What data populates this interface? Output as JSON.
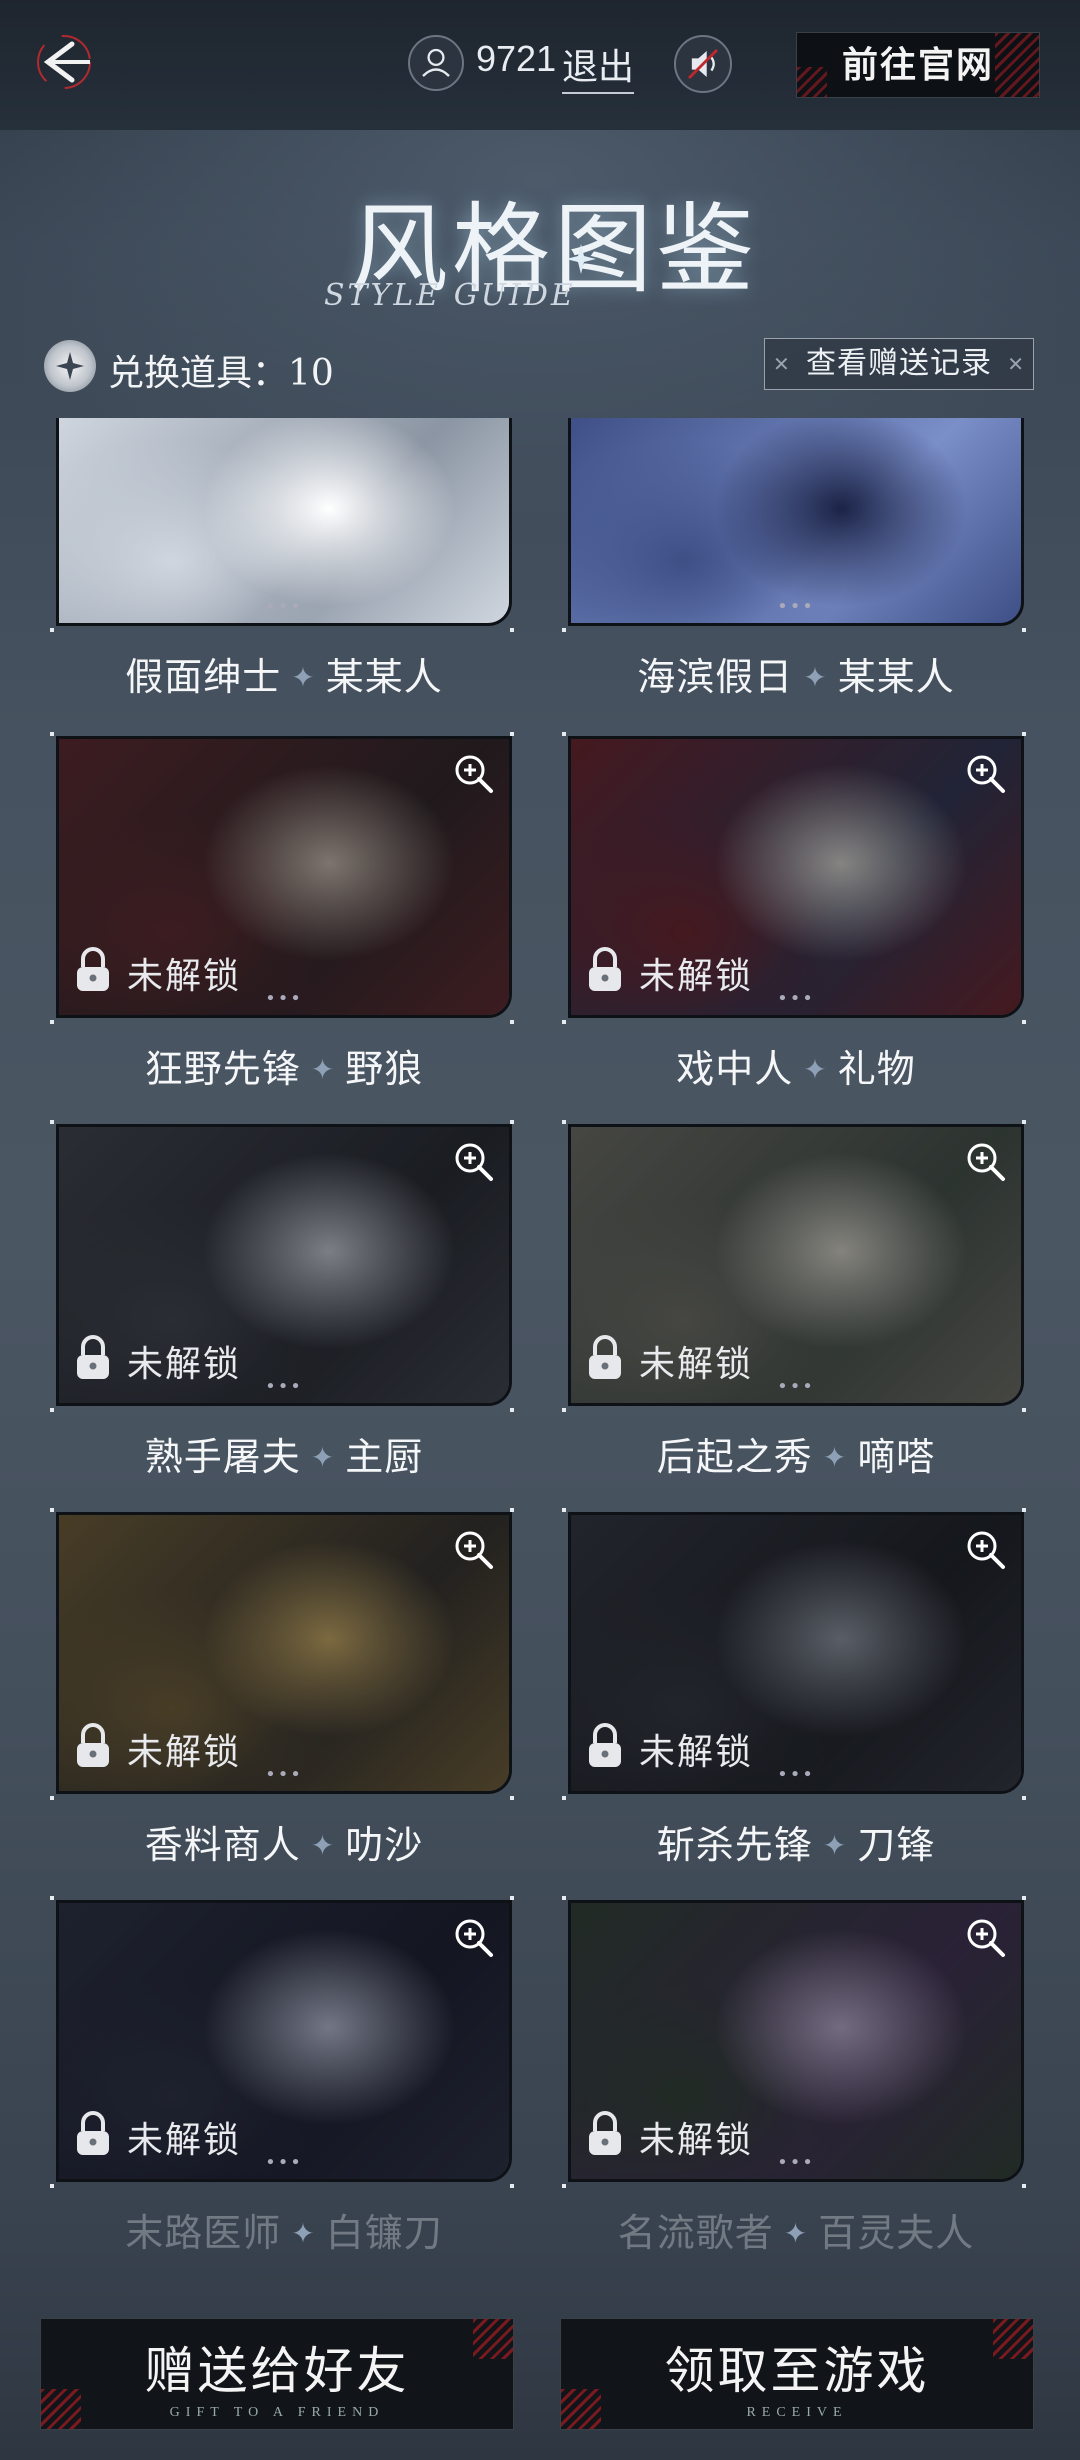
{
  "header": {
    "user_id": "9721",
    "logout_label": "退出",
    "website_button": "前往官网"
  },
  "title": {
    "main": "风格图鉴",
    "sub": "STYLE GUIDE"
  },
  "exchange": {
    "label": "兑换道具：",
    "count": "10",
    "records_button": "查看赠送记录"
  },
  "locked_text": "未解锁",
  "cards": [
    {
      "style": "假面绅士",
      "character": "某某人",
      "locked": false,
      "palette": [
        "#cfd6df",
        "#8b95a3",
        "#ffffff"
      ]
    },
    {
      "style": "海滨假日",
      "character": "某某人",
      "locked": false,
      "palette": [
        "#3e4f86",
        "#7a8ec8",
        "#1b2346"
      ]
    },
    {
      "style": "狂野先锋",
      "character": "野狼",
      "locked": true,
      "palette": [
        "#5b2224",
        "#2a1d1d",
        "#c9b9a8"
      ]
    },
    {
      "style": "戏中人",
      "character": "礼物",
      "locked": true,
      "palette": [
        "#6a1c22",
        "#2b2f4a",
        "#d8d4cc"
      ]
    },
    {
      "style": "熟手屠夫",
      "character": "主厨",
      "locked": true,
      "palette": [
        "#3b3f45",
        "#1f2226",
        "#c6cbd1"
      ]
    },
    {
      "style": "后起之秀",
      "character": "嘀嗒",
      "locked": true,
      "palette": [
        "#6b6a5e",
        "#3f4a3f",
        "#d6d2c4"
      ]
    },
    {
      "style": "香料商人",
      "character": "叻沙",
      "locked": true,
      "palette": [
        "#6e5a2e",
        "#2e2a22",
        "#c7a65a"
      ]
    },
    {
      "style": "斩杀先锋",
      "character": "刀锋",
      "locked": true,
      "palette": [
        "#2c3036",
        "#17191d",
        "#8d939b"
      ]
    },
    {
      "style": "末路医师",
      "character": "白镰刀",
      "locked": true,
      "palette": [
        "#262a3b",
        "#151826",
        "#b9bdd0"
      ]
    },
    {
      "style": "名流歌者",
      "character": "百灵夫人",
      "locked": true,
      "palette": [
        "#2c3a2c",
        "#3b2a4a",
        "#b9a9c8"
      ]
    }
  ],
  "buttons": {
    "gift": {
      "label": "赠送给好友",
      "sub": "GIFT TO A FRIEND"
    },
    "receive": {
      "label": "领取至游戏",
      "sub": "RECEIVE"
    }
  }
}
